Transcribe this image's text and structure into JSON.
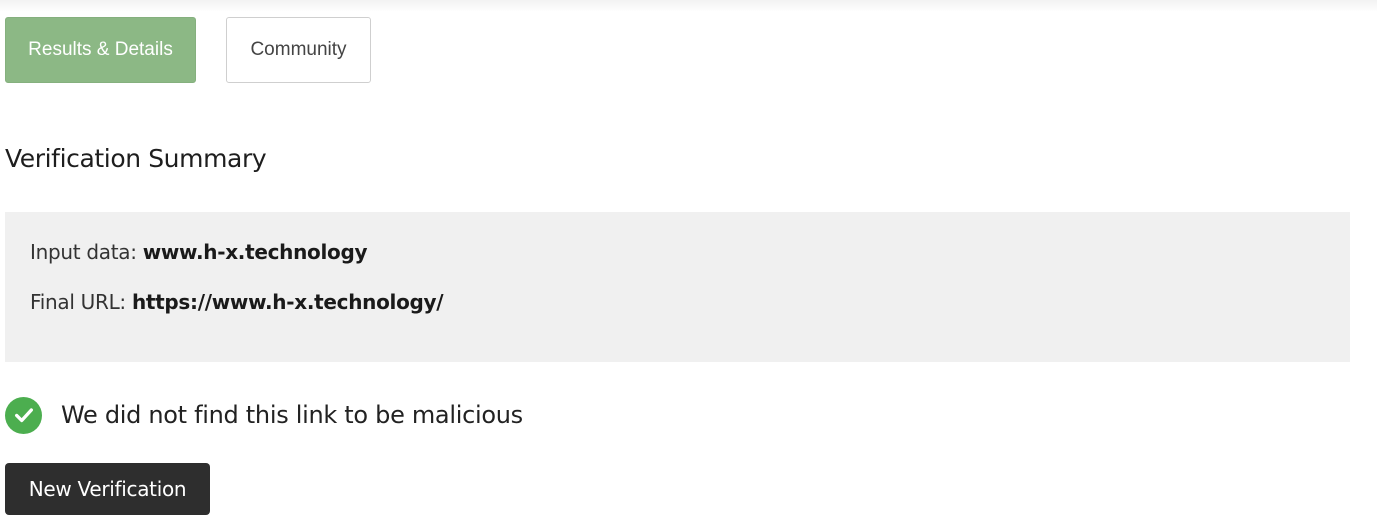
{
  "tabs": {
    "results_label": "Results & Details",
    "community_label": "Community"
  },
  "summary": {
    "title": "Verification Summary",
    "input_label": "Input data:",
    "input_value": "www.h-x.technology",
    "final_url_label": "Final URL:",
    "final_url_value": "https://www.h-x.technology/"
  },
  "result": {
    "icon": "check-circle-icon",
    "text": "We did not find this link to be malicious"
  },
  "actions": {
    "new_verification_label": "New Verification"
  },
  "colors": {
    "active_tab": "#8cb885",
    "success": "#4cae4f",
    "summary_bg": "#f0f0f0",
    "button_bg": "#2e2e2e"
  }
}
